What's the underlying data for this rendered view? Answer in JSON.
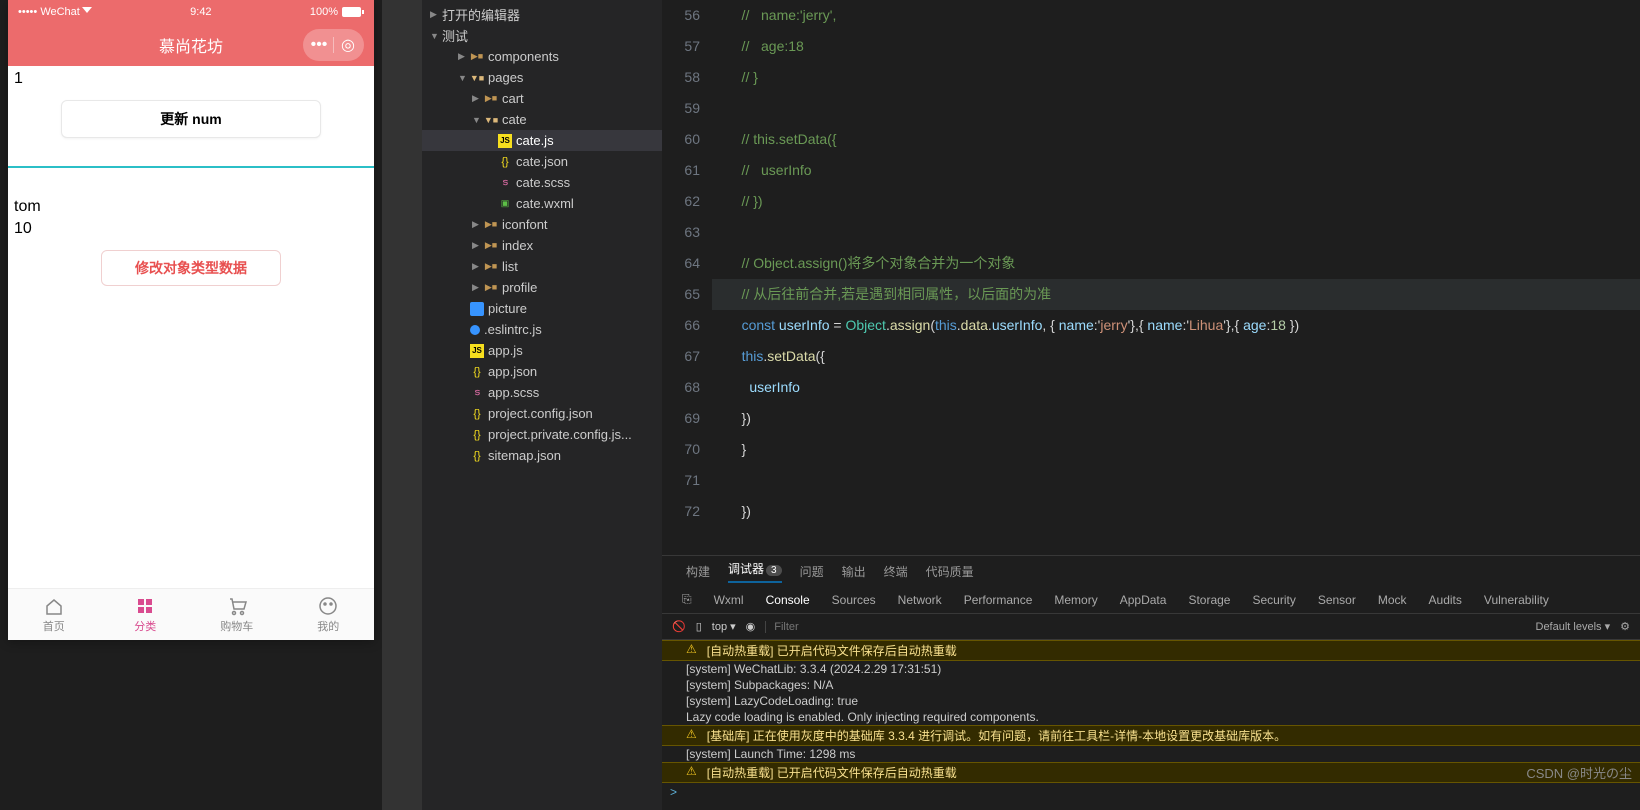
{
  "sim": {
    "carrier": "WeChat",
    "time": "9:42",
    "battery": "100%",
    "title": "慕尚花坊",
    "count": "1",
    "btn_update": "更新 num",
    "user_name": "tom",
    "user_age": "10",
    "btn_mod": "修改对象类型数据",
    "tabs": [
      "首页",
      "分类",
      "购物车",
      "我的"
    ]
  },
  "tree": {
    "top1": "打开的编辑器",
    "top2": "测试",
    "items": [
      {
        "n": "components",
        "t": "folder",
        "d": 2
      },
      {
        "n": "pages",
        "t": "folder-o",
        "d": 2,
        "open": true
      },
      {
        "n": "cart",
        "t": "folder",
        "d": 3
      },
      {
        "n": "cate",
        "t": "folder-o",
        "d": 3,
        "open": true
      },
      {
        "n": "cate.js",
        "t": "js",
        "d": 4,
        "sel": true
      },
      {
        "n": "cate.json",
        "t": "json",
        "d": 4
      },
      {
        "n": "cate.scss",
        "t": "scss",
        "d": 4
      },
      {
        "n": "cate.wxml",
        "t": "wxml",
        "d": 4
      },
      {
        "n": "iconfont",
        "t": "folder",
        "d": 3
      },
      {
        "n": "index",
        "t": "folder",
        "d": 3
      },
      {
        "n": "list",
        "t": "folder",
        "d": 3
      },
      {
        "n": "profile",
        "t": "folder",
        "d": 3
      },
      {
        "n": "picture",
        "t": "pic",
        "d": 2
      },
      {
        "n": ".eslintrc.js",
        "t": "cfg",
        "d": 2
      },
      {
        "n": "app.js",
        "t": "js",
        "d": 2
      },
      {
        "n": "app.json",
        "t": "json",
        "d": 2
      },
      {
        "n": "app.scss",
        "t": "scss",
        "d": 2
      },
      {
        "n": "project.config.json",
        "t": "json",
        "d": 2
      },
      {
        "n": "project.private.config.js...",
        "t": "json",
        "d": 2
      },
      {
        "n": "sitemap.json",
        "t": "json",
        "d": 2
      }
    ]
  },
  "code": {
    "start": 56,
    "lines": [
      "//   name:'jerry',",
      "//   age:18",
      "// }",
      "",
      "// this.setData({",
      "//   userInfo",
      "// })",
      "",
      "// Object.assign()将多个对象合并为一个对象",
      "// 从后往前合并,若是遇到相同属性，以后面的为准",
      "const userInfo = Object.assign(this.data.userInfo, { name:'jerry'},{ name:'Lihua'},{ age:18 })",
      "this.setData({",
      "  userInfo",
      "})",
      "}",
      "",
      "})"
    ],
    "highlight": 65
  },
  "panel": {
    "tabs1": [
      "构建",
      "调试器",
      "问题",
      "输出",
      "终端",
      "代码质量"
    ],
    "tabs1_active": 1,
    "tabs1_badge": "3",
    "tabs2": [
      "Wxml",
      "Console",
      "Sources",
      "Network",
      "Performance",
      "Memory",
      "AppData",
      "Storage",
      "Security",
      "Sensor",
      "Mock",
      "Audits",
      "Vulnerability"
    ],
    "tabs2_active": 1,
    "top_label": "top",
    "filter_ph": "Filter",
    "levels": "Default levels",
    "console": [
      {
        "t": "warn",
        "msg": "[自动热重载] 已开启代码文件保存后自动热重载"
      },
      {
        "t": "sys",
        "msg": "[system] WeChatLib: 3.3.4 (2024.2.29 17:31:51)"
      },
      {
        "t": "sys",
        "msg": "[system] Subpackages: N/A"
      },
      {
        "t": "sys",
        "msg": "[system] LazyCodeLoading: true"
      },
      {
        "t": "sys",
        "msg": "Lazy code loading is enabled. Only injecting required components."
      },
      {
        "t": "warn",
        "msg": "[基础库] 正在使用灰度中的基础库 3.3.4 进行调试。如有问题，请前往工具栏-详情-本地设置更改基础库版本。"
      },
      {
        "t": "sys",
        "msg": "[system] Launch Time: 1298 ms"
      },
      {
        "t": "warn",
        "msg": "[自动热重载] 已开启代码文件保存后自动热重载"
      }
    ]
  },
  "watermark": "CSDN @时光の尘"
}
